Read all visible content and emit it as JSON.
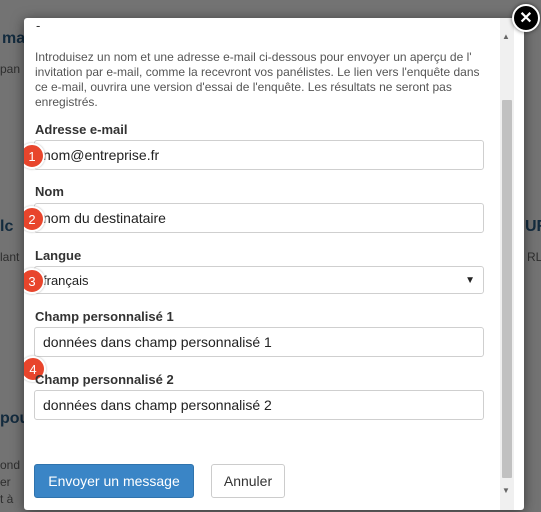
{
  "dialog": {
    "top_dash": "-",
    "intro": "Introduisez un nom et une adresse e-mail ci-dessous pour envoyer un aperçu de l' invitation par e-mail, comme la recevront vos panélistes. Le lien vers l'enquête dans ce e-mail, ouvrira une version d'essai de l'enquête. Les résultats ne seront pas enregistrés.",
    "email": {
      "label": "Adresse e-mail",
      "value": "nom@entreprise.fr"
    },
    "name": {
      "label": "Nom",
      "value": "nom du destinataire"
    },
    "language": {
      "label": "Langue",
      "value": "français"
    },
    "custom1": {
      "label": "Champ personnalisé 1",
      "value": "données dans champ personnalisé 1"
    },
    "custom2": {
      "label": "Champ personnalisé 2",
      "value": "données dans champ personnalisé 2"
    },
    "send_label": "Envoyer un message",
    "cancel_label": "Annuler",
    "close_icon": "close-icon"
  },
  "badges": [
    "1",
    "2",
    "3",
    "4"
  ],
  "background": {
    "left_top": "ma",
    "left_mid": "lc",
    "left_low": "pou",
    "right_mid": "UR",
    "right_mid2": "RL",
    "left_small1": "pan",
    "left_small2": "lant",
    "left_small3": "ond",
    "left_small4": "er",
    "left_small5": "t à"
  },
  "colors": {
    "primary": "#3a85c6",
    "badge": "#e8452c",
    "overlay": "#000000"
  }
}
